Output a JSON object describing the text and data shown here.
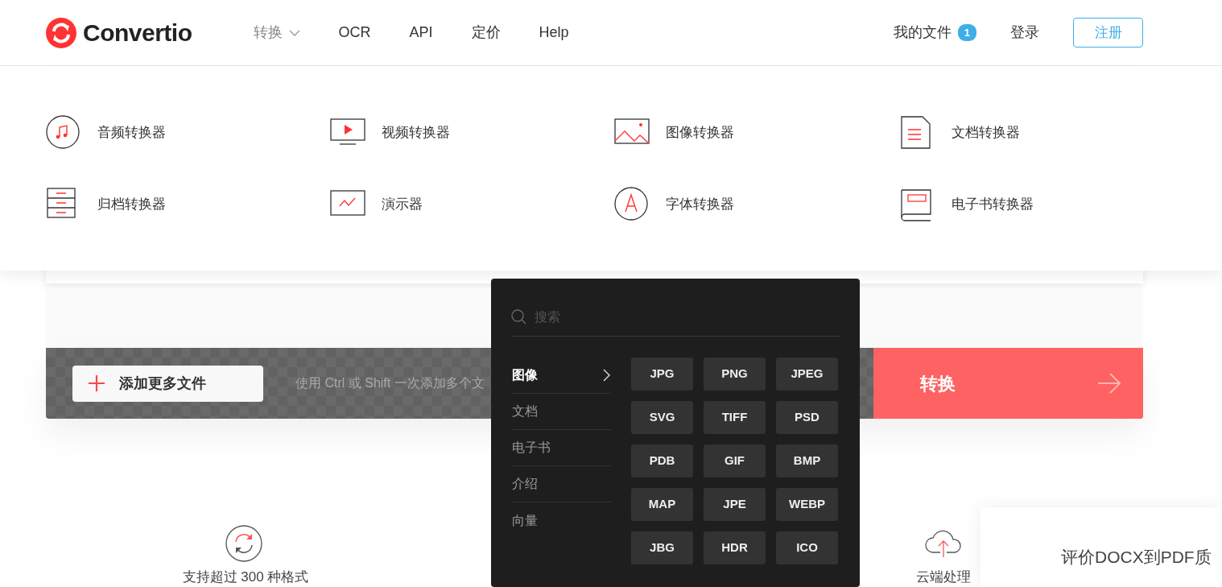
{
  "header": {
    "logo": "Convertio",
    "nav": [
      {
        "label": "转换",
        "kind": "dropdown",
        "expanded": true
      },
      {
        "label": "OCR",
        "kind": "link",
        "expanded": false
      },
      {
        "label": "API",
        "kind": "link",
        "expanded": false
      },
      {
        "label": "定价",
        "kind": "link",
        "expanded": false
      },
      {
        "label": "Help",
        "kind": "link",
        "expanded": false
      }
    ],
    "my_files": {
      "label": "我的文件",
      "count": "1"
    },
    "login": "登录",
    "signup": "注册"
  },
  "converters_menu": {
    "items": [
      "音频转换器",
      "视频转换器",
      "图像转换器",
      "文档转换器",
      "归档转换器",
      "演示器",
      "字体转换器",
      "电子书转换器"
    ]
  },
  "upload_bar": {
    "add_button": "添加更多文件",
    "hint": "使用 Ctrl 或 Shift 一次添加多个文",
    "convert_button": "转换"
  },
  "format_dropdown": {
    "search": {
      "placeholder": "搜索"
    },
    "categories": [
      {
        "label": "图像",
        "selected": true
      },
      {
        "label": "文档",
        "selected": false
      },
      {
        "label": "电子书",
        "selected": false
      },
      {
        "label": "介绍",
        "selected": false
      },
      {
        "label": "向量",
        "selected": false
      }
    ],
    "formats": [
      "JPG",
      "PNG",
      "JPEG",
      "SVG",
      "TIFF",
      "PSD",
      "PDB",
      "GIF",
      "BMP",
      "MAP",
      "JPE",
      "WEBP",
      "JBG",
      "HDR",
      "ICO"
    ]
  },
  "features": [
    {
      "label": "支持超过 300 种格式"
    },
    {
      "label": "云端处理"
    }
  ],
  "rating_card": {
    "title": "评价DOCX到PDF质"
  }
}
